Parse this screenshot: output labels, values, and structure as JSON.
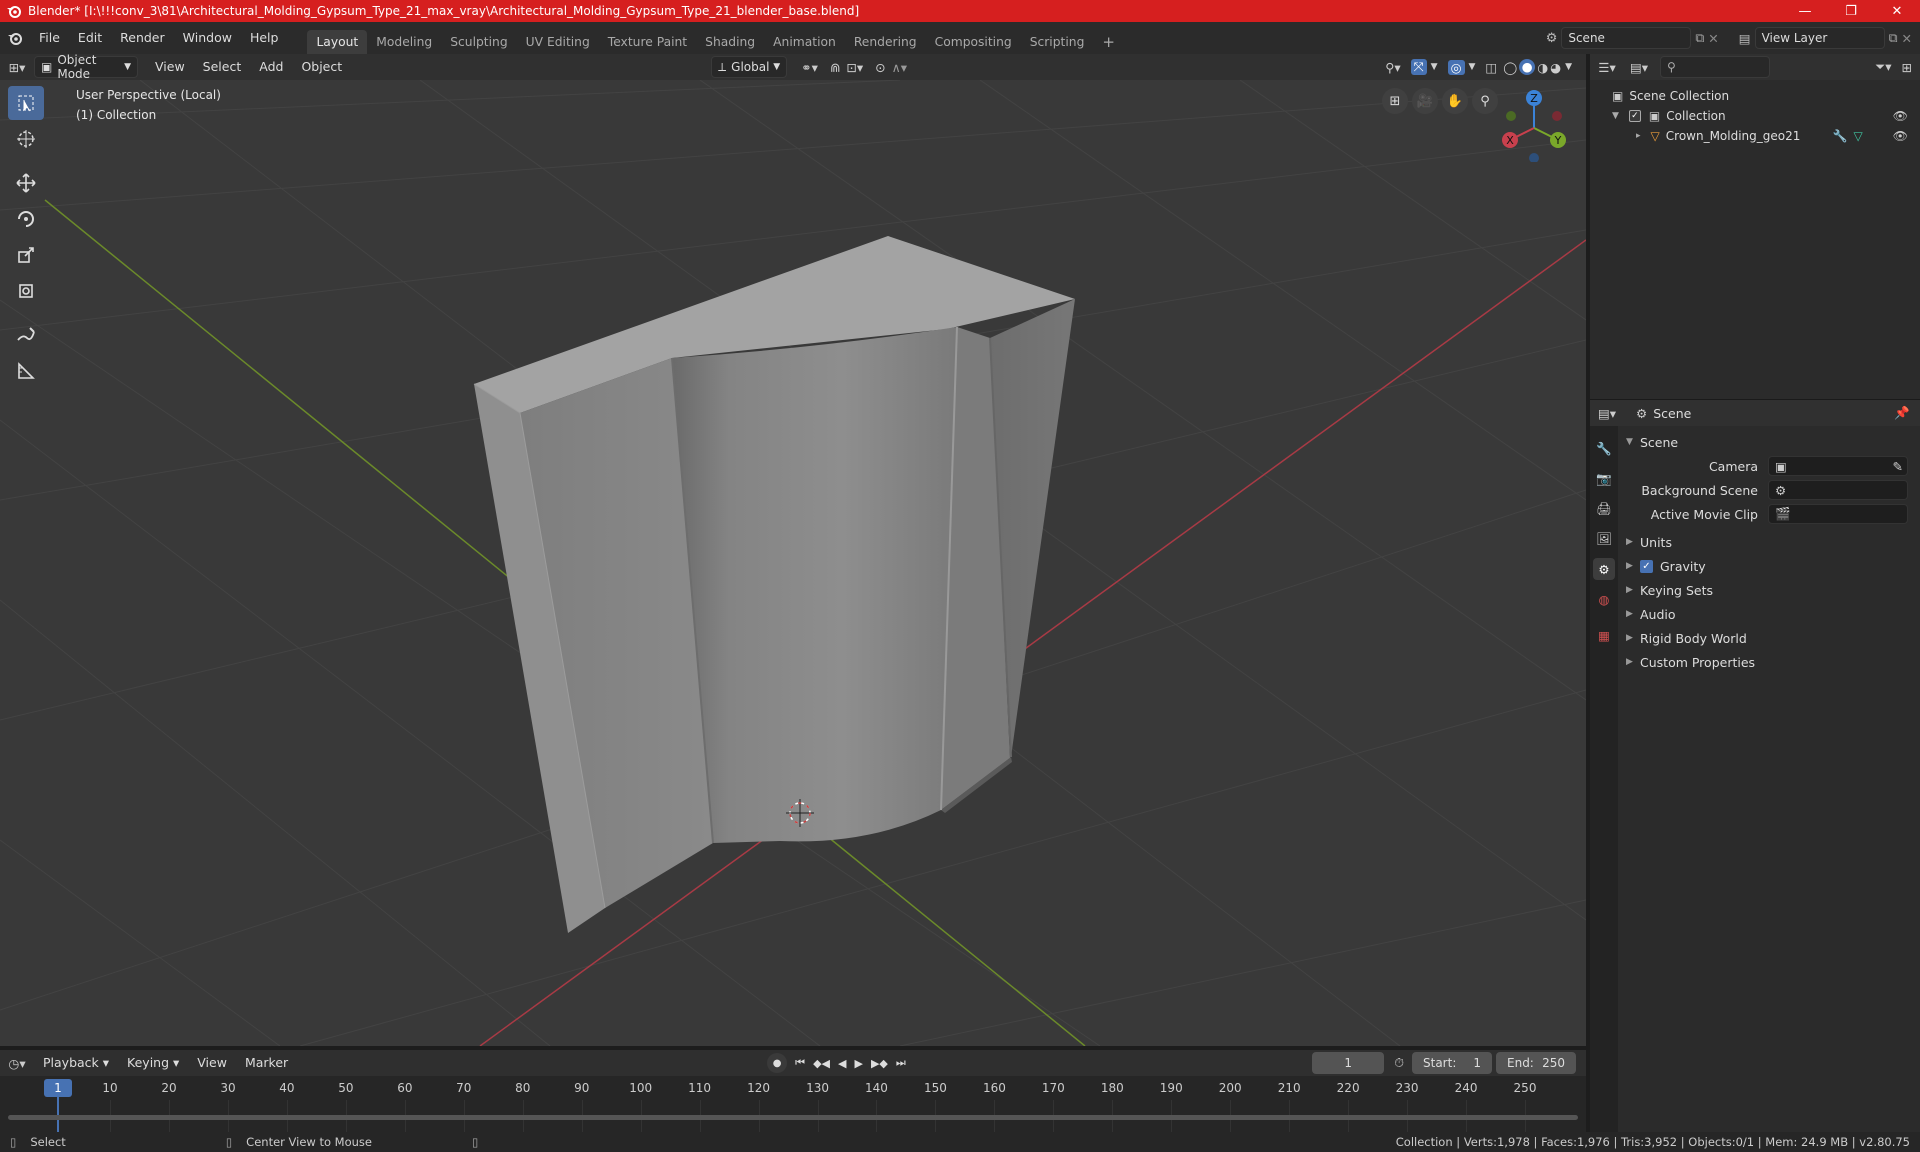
{
  "window": {
    "title": "Blender* [I:\\!!!conv_3\\81\\Architectural_Molding_Gypsum_Type_21_max_vray\\Architectural_Molding_Gypsum_Type_21_blender_base.blend]",
    "minimize": "—",
    "maximize": "❐",
    "close": "✕"
  },
  "menu": [
    "File",
    "Edit",
    "Render",
    "Window",
    "Help"
  ],
  "workspaces": [
    "Layout",
    "Modeling",
    "Sculpting",
    "UV Editing",
    "Texture Paint",
    "Shading",
    "Animation",
    "Rendering",
    "Compositing",
    "Scripting"
  ],
  "active_workspace": "Layout",
  "scene_selector": "Scene",
  "view_layer": "View Layer",
  "viewport": {
    "mode": "Object Mode",
    "menus": [
      "View",
      "Select",
      "Add",
      "Object"
    ],
    "orientation": "Global",
    "info_line1": "User Perspective (Local)",
    "info_line2": "(1) Collection"
  },
  "gizmo": {
    "x": "X",
    "y": "Y",
    "z": "Z"
  },
  "outliner": {
    "root": "Scene Collection",
    "collection": "Collection",
    "object": "Crown_Molding_geo21"
  },
  "properties": {
    "context": "Scene",
    "panel_title": "Scene",
    "camera_label": "Camera",
    "bg_scene_label": "Background Scene",
    "movie_clip_label": "Active Movie Clip",
    "sections": [
      "Units",
      "Gravity",
      "Keying Sets",
      "Audio",
      "Rigid Body World",
      "Custom Properties"
    ],
    "gravity_checked": true
  },
  "timeline": {
    "menus": [
      "Playback",
      "Keying",
      "View",
      "Marker"
    ],
    "current_frame": "1",
    "start_label": "Start:",
    "start": "1",
    "end_label": "End:",
    "end": "250",
    "ticks": [
      "1",
      "10",
      "20",
      "30",
      "40",
      "50",
      "60",
      "70",
      "80",
      "90",
      "100",
      "110",
      "120",
      "130",
      "140",
      "150",
      "160",
      "170",
      "180",
      "190",
      "200",
      "210",
      "220",
      "230",
      "240",
      "250"
    ]
  },
  "status": {
    "select": "Select",
    "center": "Center View to Mouse",
    "stats": "Collection | Verts:1,978 | Faces:1,976 | Tris:3,952 | Objects:0/1 | Mem: 24.9 MB | v2.80.75"
  },
  "colors": {
    "accent": "#4772b3",
    "title_bar": "#d61f1f",
    "x_axis": "#c8404d",
    "y_axis": "#7aa82a",
    "z_axis": "#3b83d8"
  }
}
